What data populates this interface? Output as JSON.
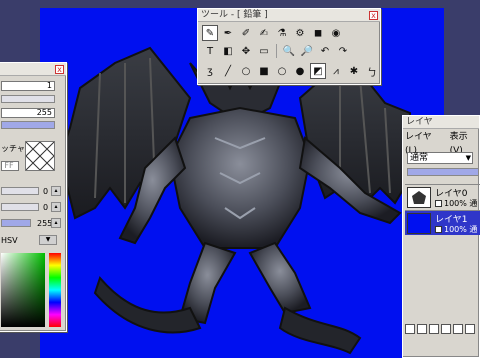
{
  "tool_window": {
    "title": "ツール - [ 鉛筆 ]",
    "close": "x",
    "tools_row1": [
      "✎",
      "✒",
      "✐",
      "✍",
      "⚗",
      "⚙",
      "◼",
      "◉"
    ],
    "tools_row2": [
      "T",
      "◧",
      "✥",
      "▭",
      "🔍",
      "🔎",
      "↶",
      "↷"
    ],
    "tools_row3": [
      "ʒ",
      "╱",
      "○",
      "■",
      "○",
      "●",
      "◩",
      "⩘",
      "✱",
      "ㄅ"
    ]
  },
  "color_panel": {
    "close": "x",
    "value_1": "1",
    "value_255a": "255",
    "label_partial": "ッチャ",
    "ff_label": "FF",
    "hsv_zero_1": "0",
    "hsv_zero_2": "0",
    "hsv_255": "255",
    "hsv_label": "HSV"
  },
  "layer_window": {
    "title": "レイヤ",
    "menu_layer": "レイヤ(L)",
    "menu_view": "表示(V)",
    "blend_mode": "通常",
    "layers": [
      {
        "name": "レイヤ0",
        "opacity": "100% 通"
      },
      {
        "name": "レイヤ1",
        "opacity": "100% 通"
      }
    ],
    "bottom_icons": [
      "new-layer-icon",
      "copy-layer-icon",
      "merge-icon",
      "folder-icon",
      "mask-icon",
      "delete-icon"
    ]
  },
  "colors": {
    "canvas_bg": "#0010f0",
    "desktop": "#3a3d6a",
    "panel": "#d9d6cf",
    "selected_layer": "#2f36c9"
  }
}
